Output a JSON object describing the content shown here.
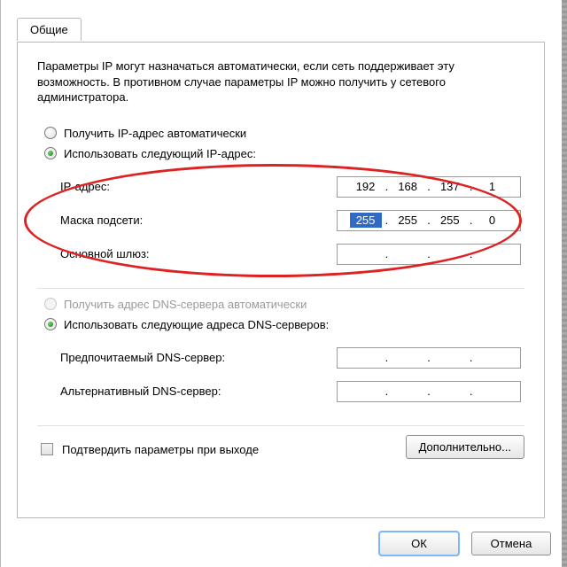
{
  "tab": {
    "label": "Общие"
  },
  "description": "Параметры IP могут назначаться автоматически, если сеть поддерживает эту возможность. В противном случае параметры IP можно получить у сетевого администратора.",
  "ip": {
    "radio_auto": "Получить IP-адрес автоматически",
    "radio_manual": "Использовать следующий IP-адрес:",
    "address_label": "IP-адрес:",
    "address": [
      "192",
      "168",
      "137",
      "1"
    ],
    "mask_label": "Маска подсети:",
    "mask": [
      "255",
      "255",
      "255",
      "0"
    ],
    "gateway_label": "Основной шлюз:",
    "gateway": [
      "",
      "",
      "",
      ""
    ]
  },
  "dns": {
    "radio_auto": "Получить адрес DNS-сервера автоматически",
    "radio_manual": "Использовать следующие адреса DNS-серверов:",
    "preferred_label": "Предпочитаемый DNS-сервер:",
    "preferred": [
      "",
      "",
      "",
      ""
    ],
    "alternate_label": "Альтернативный DNS-сервер:",
    "alternate": [
      "",
      "",
      "",
      ""
    ]
  },
  "validate_checkbox": "Подтвердить параметры при выходе",
  "buttons": {
    "advanced": "Дополнительно...",
    "ok": "ОК",
    "cancel": "Отмена"
  }
}
